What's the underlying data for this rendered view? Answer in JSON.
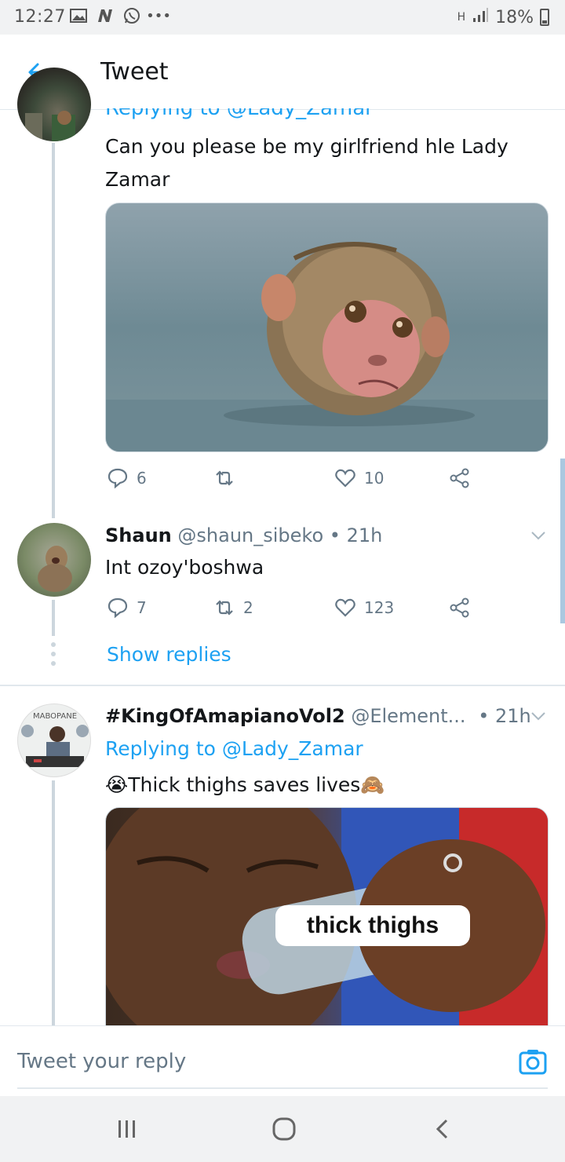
{
  "status_bar": {
    "time": "12:27",
    "network": "H",
    "battery": "18%"
  },
  "header": {
    "title": "Tweet"
  },
  "tweet1": {
    "replying": "Replying to @Lady_Zamar",
    "text": "Can you please be my girlfriend hle Lady Zamar",
    "replies": "6",
    "retweets": "",
    "likes": "10"
  },
  "tweet2": {
    "name": "Shaun",
    "handle": "@shaun_sibeko",
    "time": "• 21h",
    "text": "Int ozoy'boshwa",
    "replies": "7",
    "retweets": "2",
    "likes": "123",
    "show_replies": "Show replies"
  },
  "tweet3": {
    "name": "#KingOfAmapianoVol2",
    "handle": "@Element...",
    "time": "• 21h",
    "replying": "Replying to @Lady_Zamar",
    "text_prefix": "😭",
    "text": "Thick thighs saves lives",
    "text_suffix": "🙈",
    "avatar_sign": "MABOPANE",
    "image_caption": "thick thighs"
  },
  "reply_bar": {
    "placeholder": "Tweet your reply"
  },
  "colors": {
    "accent": "#1da1f2",
    "muted": "#657786",
    "divider": "#e1e8ed"
  }
}
